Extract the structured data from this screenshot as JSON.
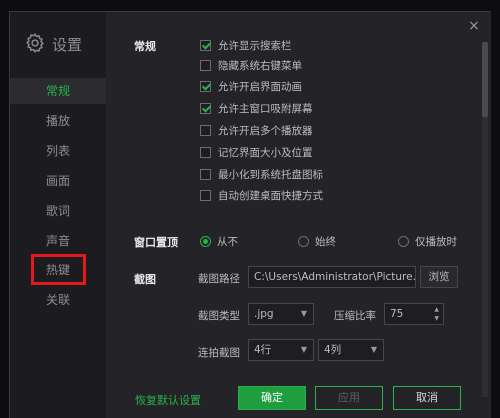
{
  "sidebar": {
    "title": "设置",
    "items": [
      {
        "label": "常规"
      },
      {
        "label": "播放"
      },
      {
        "label": "列表"
      },
      {
        "label": "画面"
      },
      {
        "label": "歌词"
      },
      {
        "label": "声音"
      },
      {
        "label": "热键"
      },
      {
        "label": "关联"
      }
    ]
  },
  "close_label": "×",
  "general": {
    "section_label": "常规",
    "options": [
      {
        "label": "允许显示搜索栏",
        "checked": true
      },
      {
        "label": "隐藏系统右键菜单",
        "checked": false
      },
      {
        "label": "允许开启界面动画",
        "checked": true
      },
      {
        "label": "允许主窗口吸附屏幕",
        "checked": true
      },
      {
        "label": "允许开启多个播放器",
        "checked": false
      },
      {
        "label": "记忆界面大小及位置",
        "checked": false
      },
      {
        "label": "最小化到系统托盘图标",
        "checked": false
      },
      {
        "label": "自动创建桌面快捷方式",
        "checked": false
      }
    ]
  },
  "window_top": {
    "section_label": "窗口置顶",
    "options": [
      "从不",
      "始终",
      "仅播放时"
    ],
    "selected": "从不"
  },
  "screenshot": {
    "section_label": "截图",
    "path_label": "截图路径",
    "path_value": "C:\\Users\\Administrator\\Picture...\\",
    "browse_label": "浏览",
    "type_label": "截图类型",
    "type_value": ".jpg",
    "ratio_label": "压缩比率",
    "ratio_value": "75",
    "burst_label": "连拍截图",
    "rows_value": "4行",
    "cols_value": "4列"
  },
  "footer": {
    "restore_label": "恢复默认设置",
    "ok_label": "确定",
    "apply_label": "应用",
    "cancel_label": "取消"
  },
  "colors": {
    "accent": "#27b34a",
    "highlight_box": "#e21a1a",
    "background": "#242428",
    "sidebar": "#1c1c20"
  }
}
